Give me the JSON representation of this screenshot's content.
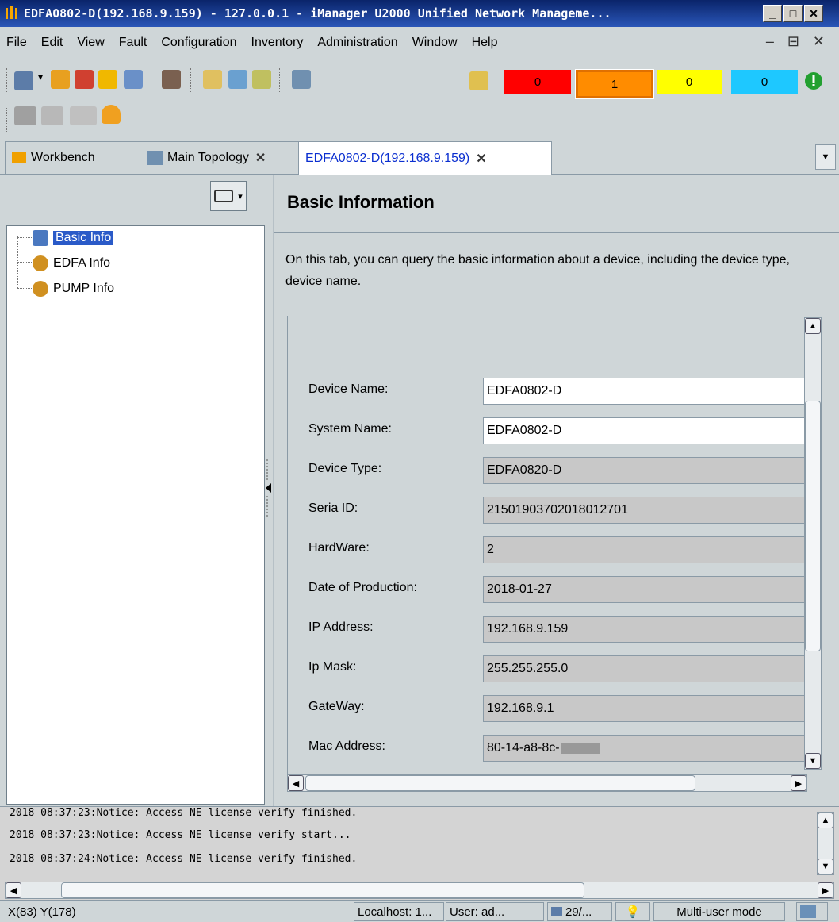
{
  "window": {
    "title": "EDFA0802-D(192.168.9.159) - 127.0.0.1 - iManager U2000 Unified Network Manageme...",
    "buttons": [
      "_",
      "□",
      "✕"
    ]
  },
  "menu": {
    "items": [
      "File",
      "Edit",
      "View",
      "Fault",
      "Configuration",
      "Inventory",
      "Administration",
      "Window",
      "Help"
    ],
    "right_controls": "– ⊟ ✕"
  },
  "toolbar": {
    "alarms": {
      "critical": "0",
      "major": "1",
      "minor": "0",
      "warning": "0"
    },
    "colors": {
      "critical": "#ff0000",
      "major": "#ff8c00",
      "minor": "#ffff00",
      "warning": "#1ec8ff"
    }
  },
  "tabs": [
    {
      "label": "Workbench"
    },
    {
      "label": "Main Topology",
      "close": "✕"
    },
    {
      "label": "EDFA0802-D(192.168.9.159)",
      "close": "✕",
      "active": true
    }
  ],
  "tree": {
    "items": [
      {
        "label": "Basic Info",
        "selected": true,
        "icon": "basic-info-icon"
      },
      {
        "label": "EDFA Info",
        "icon": "gear-folder-icon"
      },
      {
        "label": "PUMP Info",
        "icon": "gear-folder-icon"
      }
    ]
  },
  "content": {
    "title": "Basic Information",
    "description": "On this tab, you can query the basic information about a device, including the device type, device name.",
    "fields": [
      {
        "label": "Device Name:",
        "value": "EDFA0802-D",
        "editable": true
      },
      {
        "label": "System Name:",
        "value": "EDFA0802-D",
        "editable": true
      },
      {
        "label": "Device Type:",
        "value": "EDFA0820-D",
        "editable": false
      },
      {
        "label": "Seria ID:",
        "value": "21501903702018012701",
        "editable": false
      },
      {
        "label": "HardWare:",
        "value": "2",
        "editable": false
      },
      {
        "label": "Date of Production:",
        "value": "2018-01-27",
        "editable": false
      },
      {
        "label": "IP Address:",
        "value": "192.168.9.159",
        "editable": false
      },
      {
        "label": "Ip Mask:",
        "value": "255.255.255.0",
        "editable": false
      },
      {
        "label": "GateWay:",
        "value": "192.168.9.1",
        "editable": false
      },
      {
        "label": "Mac Address:",
        "value": "80-14-a8-8c-",
        "editable": false
      }
    ]
  },
  "log": {
    "lines": [
      "2018 08:37:23:Notice: Access NE license verify finished.",
      "2018 08:37:23:Notice: Access NE license verify start...",
      "2018 08:37:24:Notice: Access NE license verify finished."
    ]
  },
  "status": {
    "coords": "X(83)  Y(178)",
    "server": "Localhost: 1...",
    "user": "User: ad...",
    "count": "29/...",
    "mode": "Multi-user mode"
  }
}
